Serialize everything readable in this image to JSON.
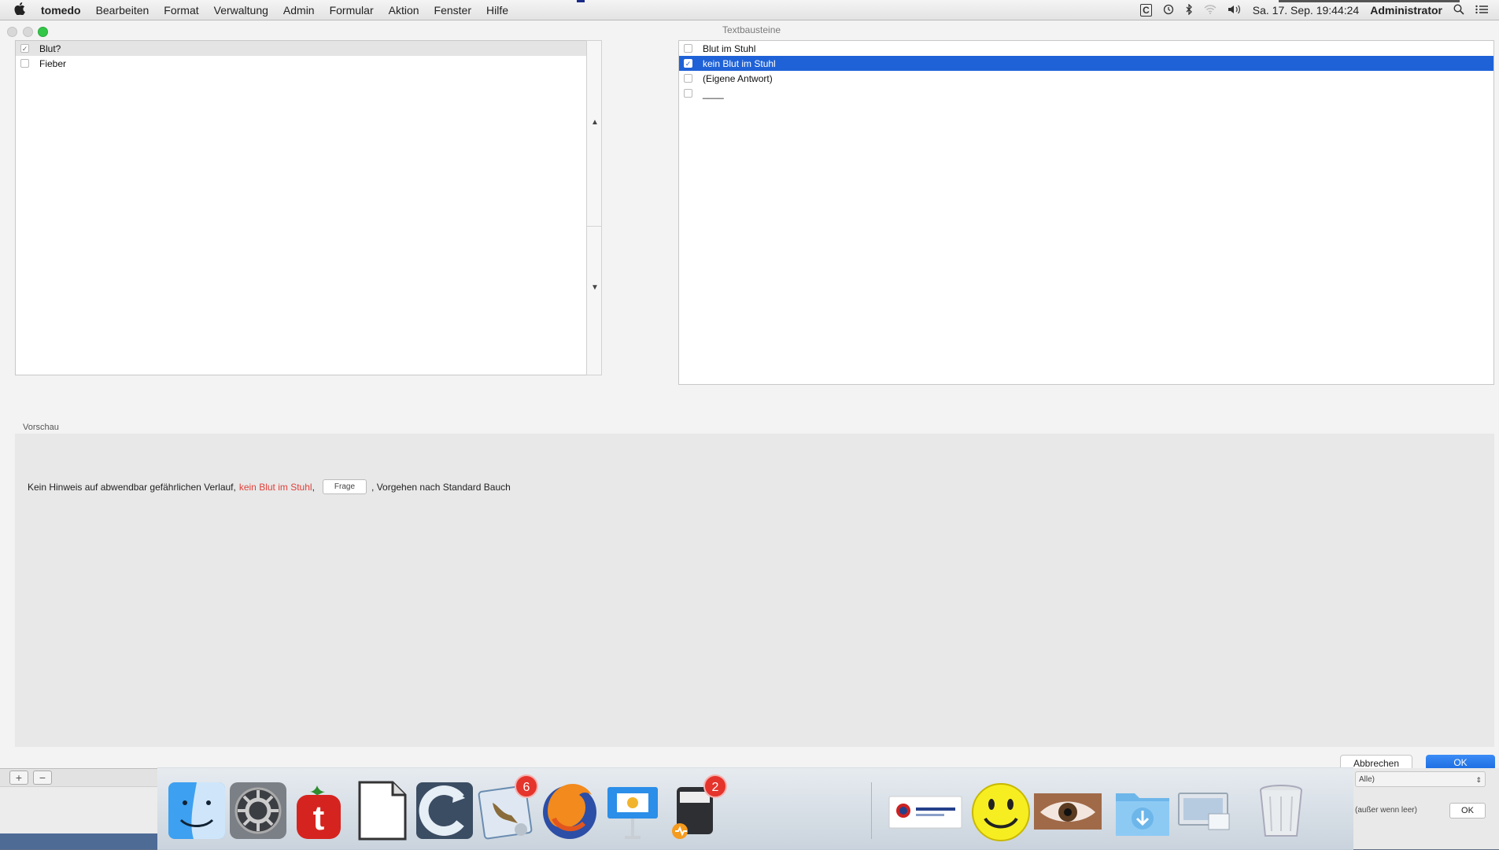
{
  "menubar": {
    "app_name": "tomedo",
    "items": [
      "Bearbeiten",
      "Format",
      "Verwaltung",
      "Admin",
      "Formular",
      "Aktion",
      "Fenster",
      "Hilfe"
    ],
    "status_glyph": "C",
    "datetime": "Sa. 17. Sep. 19:44:24",
    "user": "Administrator"
  },
  "window": {
    "right_panel_title": "Textbausteine",
    "left_items": [
      {
        "label": "Blut?",
        "checked": true,
        "selected": "grey"
      },
      {
        "label": "Fieber",
        "checked": false,
        "selected": "none"
      }
    ],
    "right_items": [
      {
        "label": "Blut im Stuhl",
        "checked": false,
        "selected": "none"
      },
      {
        "label": "kein Blut im Stuhl",
        "checked": true,
        "selected": "blue"
      },
      {
        "label": "(Eigene Antwort)",
        "checked": false,
        "selected": "none"
      },
      {
        "label": "____",
        "checked": false,
        "selected": "none"
      }
    ],
    "preview": {
      "label": "Vorschau",
      "text_before": "Kein Hinweis auf abwendbar gefährlichen Verlauf,",
      "text_highlight": "kein Blut im Stuhl",
      "text_after_highlight": ",",
      "frage_button": "Frage",
      "text_end": ", Vorgehen nach Standard Bauch"
    },
    "cancel_label": "Abbrechen",
    "ok_label": "OK"
  },
  "under": {
    "plus_label": "+",
    "minus_label": "−",
    "select_value": "Alle)",
    "note": "(außer wenn leer)",
    "ok_label": "OK"
  },
  "dock": {
    "mail_badge": "6",
    "printer_badge": "2",
    "items": [
      "finder-icon",
      "system-preferences-icon",
      "tomedo-icon",
      "document-icon",
      "sync-icon",
      "mail-icon",
      "firefox-icon",
      "keynote-icon",
      "printer-icon",
      "logo-app-icon",
      "smiley-icon",
      "eye-icon",
      "downloads-folder-icon",
      "screen-share-icon",
      "trash-icon"
    ]
  },
  "colors": {
    "selection_blue": "#1f62d7",
    "highlight_red": "#e0403a",
    "ok_blue": "#1a6ae0",
    "zoom_green": "#33c748"
  }
}
